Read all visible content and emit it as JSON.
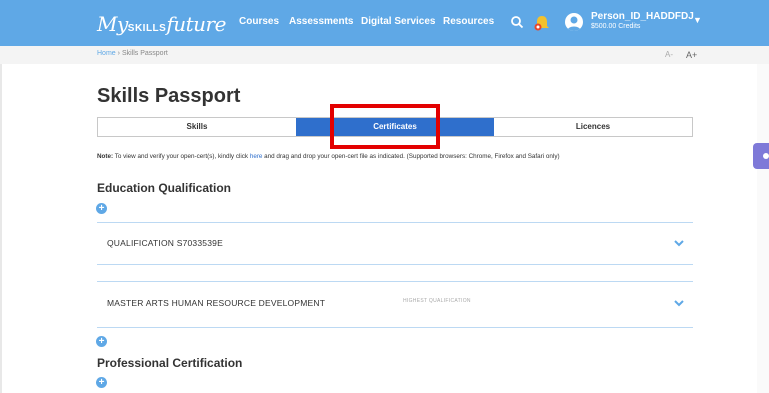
{
  "header": {
    "logo_my": "My",
    "logo_skills": "SKILLS",
    "logo_future": "future",
    "nav": [
      "Courses",
      "Assessments",
      "Digital Services",
      "Resources"
    ],
    "username": "Person_ID_HADDFDJ",
    "credits": "$500.00 Credits",
    "brand_color": "#5fa8e6"
  },
  "breadcrumb": {
    "home": "Home",
    "separator": "›",
    "current": "Skills Passport"
  },
  "font_controls": {
    "decrease": "A-",
    "increase": "A+"
  },
  "page": {
    "title": "Skills Passport",
    "tabs": [
      {
        "label": "Skills",
        "active": false
      },
      {
        "label": "Certificates",
        "active": true
      },
      {
        "label": "Licences",
        "active": false
      }
    ],
    "note": {
      "label": "Note:",
      "text_before": " To view and verify your open-cert(s), kindly click ",
      "link": "here",
      "text_after": " and drag and drop your open-cert file as indicated. (Supported browsers: Chrome, Firefox and Safari only)"
    }
  },
  "education": {
    "title": "Education Qualification",
    "items": [
      {
        "name": "QUALIFICATION S7033539E",
        "tag": ""
      },
      {
        "name": "MASTER ARTS HUMAN RESOURCE DEVELOPMENT",
        "tag": "HIGHEST QUALIFICATION"
      }
    ]
  },
  "professional": {
    "title": "Professional Certification"
  },
  "icons": {
    "add": "plus-circle-icon",
    "expand": "chevron-down-icon"
  },
  "colors": {
    "active_tab": "#2f6fcc",
    "highlight": "#e30000"
  }
}
